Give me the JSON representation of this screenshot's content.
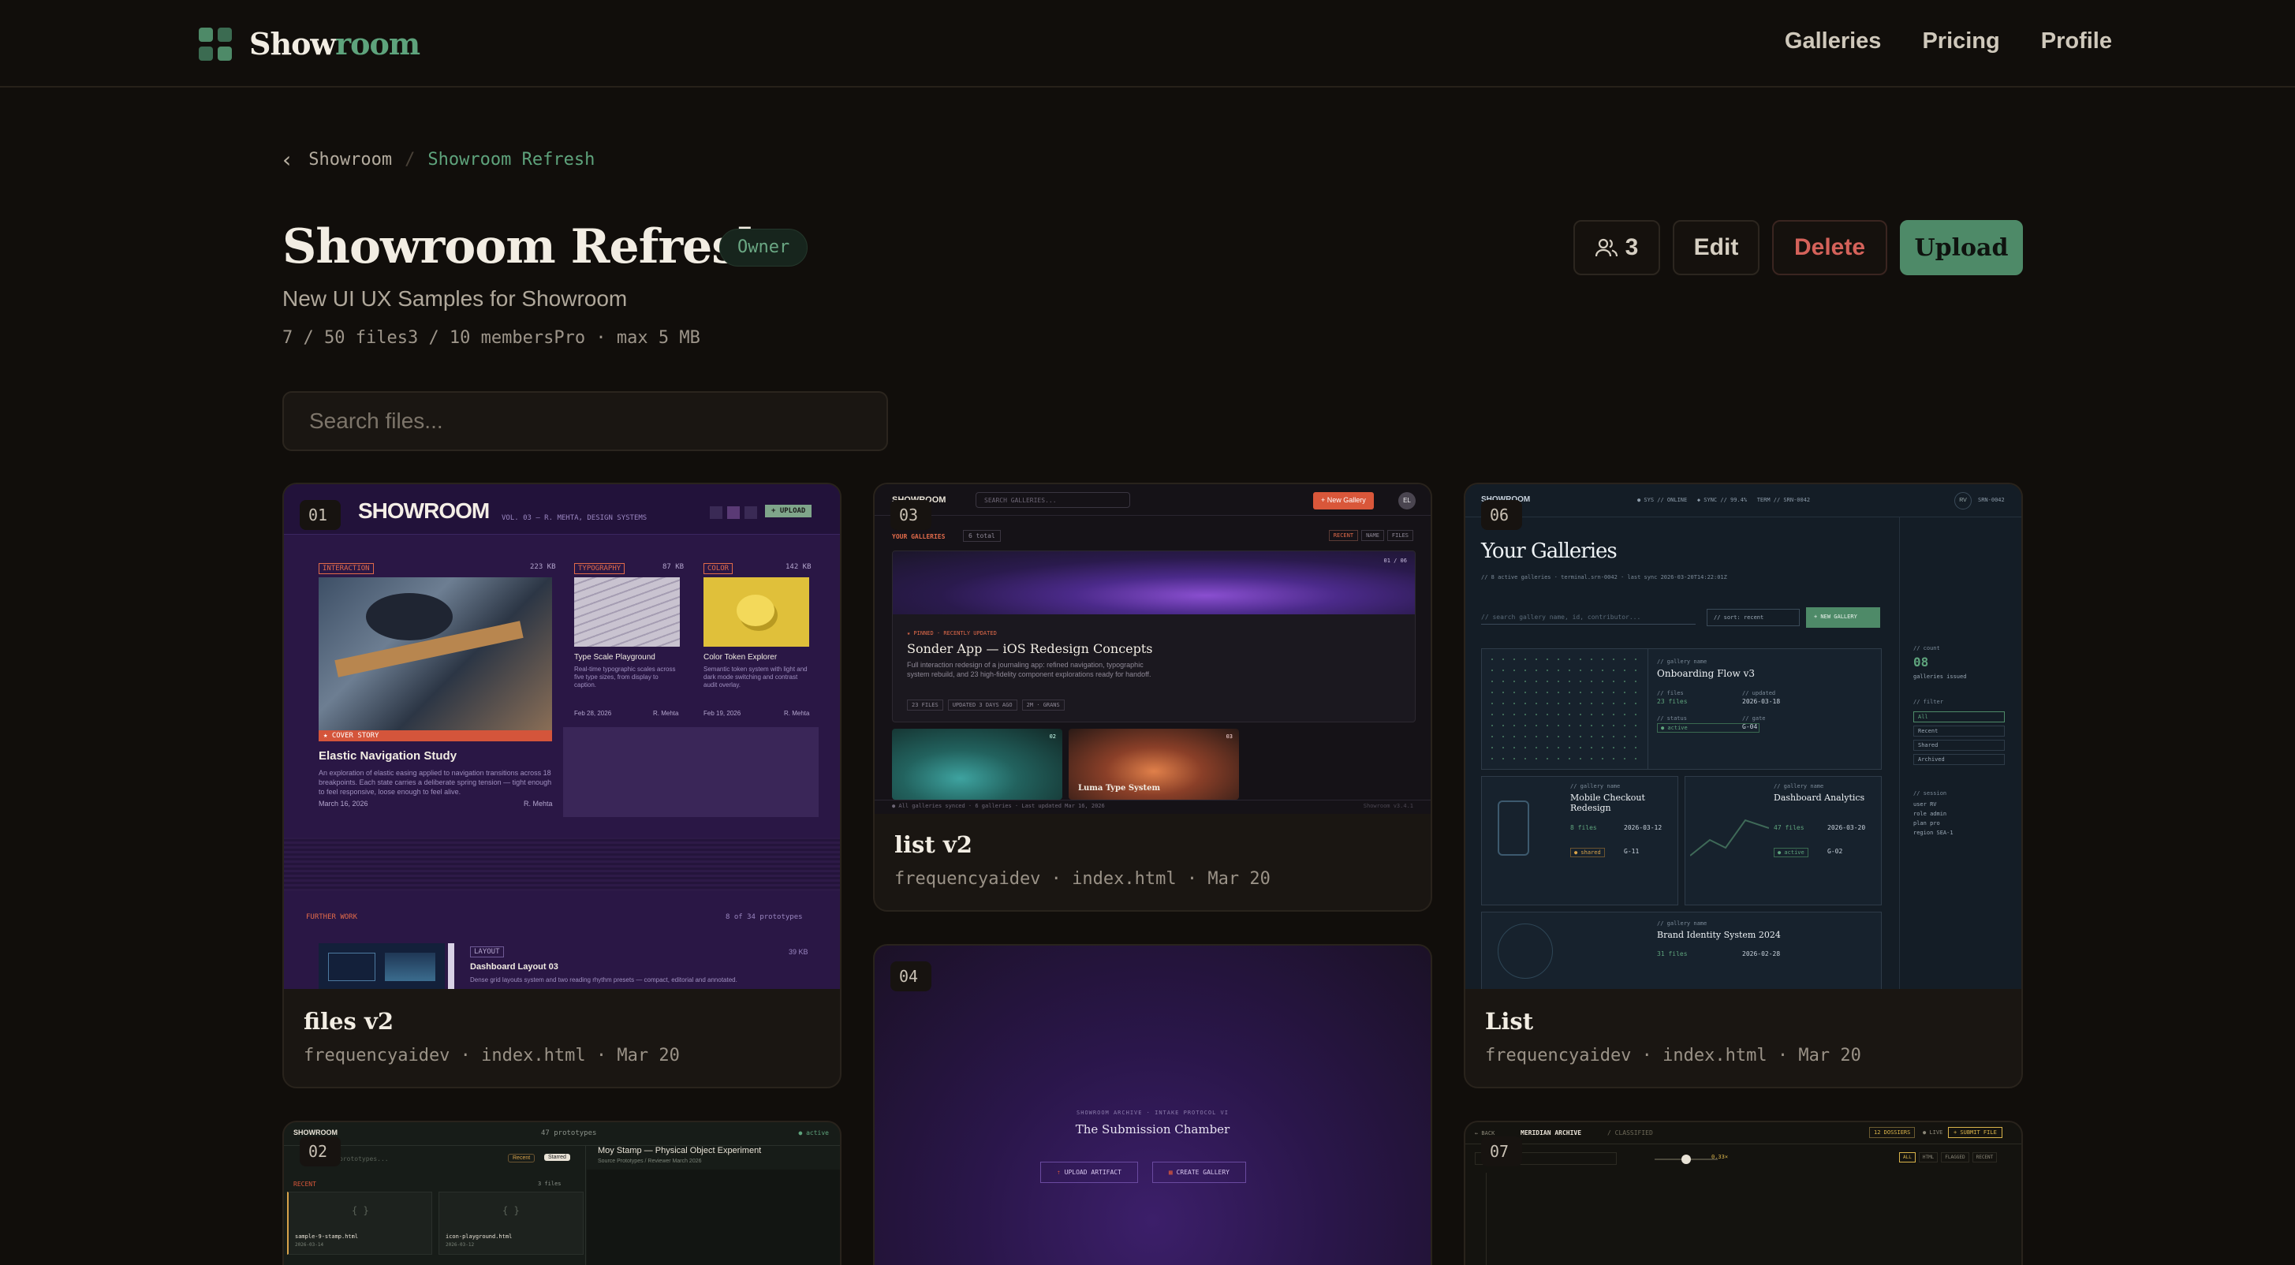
{
  "app": {
    "brand_a": "Show",
    "brand_b": "room"
  },
  "nav": {
    "links": [
      "Galleries",
      "Pricing",
      "Profile"
    ]
  },
  "breadcrumb": {
    "parent": "Showroom",
    "separator": "/",
    "current": "Showroom Refresh"
  },
  "gallery": {
    "title": "Showroom Refresh",
    "role_badge": "Owner",
    "subtitle": "New UI UX Samples for Showroom",
    "files": "7 / 50 files",
    "members": "3 / 10 members",
    "plan": "Pro · max 5 MB"
  },
  "actions": {
    "members_count": "3",
    "edit": "Edit",
    "delete": "Delete",
    "upload": "Upload"
  },
  "search": {
    "placeholder": "Search files..."
  },
  "colors": {
    "bg": "#110e0b",
    "accent": "#4e8a68",
    "danger": "#d4625a"
  },
  "cards": [
    {
      "num": "01",
      "title": "files v2",
      "meta": "frequencyaidev · index.html · Mar 20",
      "preview": {
        "logo": "SHOWROOM",
        "vol": "VOL. 03 — R. MEHTA, DESIGN SYSTEMS",
        "upload": "+ UPLOAD",
        "tags": [
          "INTERACTION",
          "TYPOGRAPHY",
          "COLOR"
        ],
        "sizes": [
          "223 KB",
          "87 KB",
          "142 KB"
        ],
        "cover": "★ COVER STORY",
        "feature": "Elastic Navigation Study",
        "feature_desc": "An exploration of elastic easing applied to navigation transitions across 18 breakpoints. Each state carries a deliberate spring tension — tight enough to feel responsive, loose enough to feel alive.",
        "feature_date": "March 16, 2026",
        "feature_author": "R. Mehta",
        "item2": "Type Scale Playground",
        "item2_desc": "Real-time typographic scales across five type sizes, from display to caption.",
        "item2_date": "Feb 28, 2026",
        "item2_author": "R. Mehta",
        "item3": "Color Token Explorer",
        "item3_desc": "Semantic token system with light and dark mode switching and contrast audit overlay.",
        "item3_date": "Feb 19, 2026",
        "item3_author": "R. Mehta",
        "further": "FURTHER WORK",
        "further_count": "8 of 34 prototypes",
        "layout_tag": "LAYOUT",
        "layout_title": "Dashboard Layout 03",
        "layout_size": "39 KB",
        "layout_desc": "Dense grid layouts system and two reading rhythm presets — compact, editorial and annotated."
      }
    },
    {
      "num": "03",
      "title": "list v2",
      "meta": "frequencyaidev · index.html · Mar 20",
      "preview": {
        "logo": "SHOWROOM",
        "search": "SEARCH GALLERIES...",
        "new": "+ New Gallery",
        "avatar": "EL",
        "section": "YOUR GALLERIES",
        "count": "6 total",
        "sort": [
          "RECENT",
          "NAME",
          "FILES"
        ],
        "pinned": "★ PINNED · RECENTLY UPDATED",
        "pinned_idx": "01 / 06",
        "hero_title": "Sonder App — iOS Redesign Concepts",
        "hero_desc": "Full interaction redesign of a journaling app: refined navigation, typographic system rebuild, and 23 high-fidelity component explorations ready for handoff.",
        "chips": [
          "23 FILES",
          "UPDATED 3 DAYS AGO",
          "2M · GRANS"
        ],
        "second": "Luma Type System",
        "idx2": "02",
        "idx3": "03",
        "footer": "● All galleries synced · 6 galleries · Last updated Mar 16, 2026",
        "footer_right": "Showroom v3.4.1"
      }
    },
    {
      "num": "06",
      "title": "List",
      "meta": "frequencyaidev · index.html · Mar 20",
      "preview": {
        "logo": "SHOWROOM",
        "status": "● SYS // ONLINE   ◆ SYNC // 99.4%   TERM // SRN-0042",
        "avatar": "RV",
        "term": "SRN-0042",
        "heading": "Your Galleries",
        "subhead": "// 8 active galleries · terminal.srn-0042 · last sync 2026-03-20T14:22:01Z",
        "search_label": "// search",
        "search_ph": "gallery name, id, contributor...",
        "sort": "// sort: recent",
        "new": "+ NEW GALLERY",
        "g1": "Onboarding Flow v3",
        "g1_files": "23 files",
        "g1_updated": "2026-03-18",
        "g1_status": "● active",
        "g1_gate": "G-04",
        "g2": "Mobile Checkout Redesign",
        "g2_files": "8 files",
        "g2_updated": "2026-03-12",
        "g2_status": "● shared",
        "g2_gate": "G-11",
        "g3": "Dashboard Analytics",
        "g3_files": "47 files",
        "g3_updated": "2026-03-20",
        "g3_status": "● active",
        "g3_gate": "G-02",
        "g4": "Brand Identity System 2024",
        "g4_files": "31 files",
        "g4_updated": "2026-02-28",
        "side_count_label": "// count",
        "side_count": "08",
        "side_count_sub": "galleries issued",
        "side_filter": "// filter",
        "filters": [
          "All",
          "Recent",
          "Shared",
          "Archived"
        ],
        "side_session": "// session",
        "session": [
          "user RV",
          "role admin",
          "plan pro",
          "region SEA-1"
        ]
      }
    },
    {
      "num": "04",
      "title": "",
      "meta": "",
      "preview": {
        "kicker": "SHOWROOM ARCHIVE · INTAKE PROTOCOL VI",
        "title": "The Submission Chamber",
        "btn1": "UPLOAD ARTIFACT",
        "btn2": "CREATE GALLERY"
      }
    },
    {
      "num": "02",
      "title": "",
      "meta": "",
      "preview": {
        "logo": "SHOWROOM",
        "center": "47 prototypes",
        "right": "● active",
        "search": "prototypes...",
        "tab1": "Recent",
        "tab2": "Starred",
        "recent": "RECENT",
        "files": "3 files",
        "f1": "sample-9-stamp.html",
        "f1_date": "2026-03-14",
        "f2": "icon-playground.html",
        "f2_date": "2026-03-12",
        "detail_title": "Moy Stamp — Physical Object Experiment",
        "detail_sub": "Source Prototypes / Reviewer March 2026"
      }
    },
    {
      "num": "07",
      "title": "",
      "meta": "",
      "preview": {
        "back": "← BACK",
        "archive": "MERIDIAN ARCHIVE",
        "sub": "/ CLASSIFIED",
        "dossiers": "12 DOSSIERS",
        "live": "● LIVE",
        "submit": "+ SUBMIT FILE",
        "zoom": "0.33×",
        "filters": [
          "ALL",
          "HTML",
          "FLAGGED",
          "RECENT"
        ]
      }
    }
  ]
}
